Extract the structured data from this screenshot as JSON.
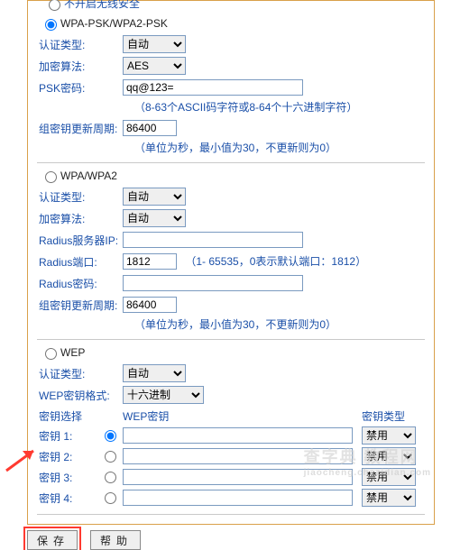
{
  "sec0": {
    "opt_label": "不开启无线安全"
  },
  "sec1": {
    "opt_label": "WPA-PSK/WPA2-PSK",
    "auth_label": "认证类型:",
    "auth_value": "自动",
    "algo_label": "加密算法:",
    "algo_value": "AES",
    "psk_label": "PSK密码:",
    "psk_value": "qq@123=",
    "psk_hint": "（8-63个ASCII码字符或8-64个十六进制字符）",
    "gkp_label": "组密钥更新周期:",
    "gkp_value": "86400",
    "gkp_hint": "（单位为秒，最小值为30，不更新则为0）"
  },
  "sec2": {
    "opt_label": "WPA/WPA2",
    "auth_label": "认证类型:",
    "auth_value": "自动",
    "algo_label": "加密算法:",
    "algo_value": "自动",
    "radius_ip_label": "Radius服务器IP:",
    "radius_ip_value": "",
    "radius_port_label": "Radius端口:",
    "radius_port_value": "1812",
    "radius_port_hint": "（1- 65535，0表示默认端口：1812）",
    "radius_pwd_label": "Radius密码:",
    "radius_pwd_value": "",
    "gkp_label": "组密钥更新周期:",
    "gkp_value": "86400",
    "gkp_hint": "（单位为秒，最小值为30，不更新则为0）"
  },
  "sec3": {
    "opt_label": "WEP",
    "auth_label": "认证类型:",
    "auth_value": "自动",
    "fmt_label": "WEP密钥格式:",
    "fmt_value": "十六进制",
    "head_sel": "密钥选择",
    "head_key": "WEP密钥",
    "head_type": "密钥类型",
    "rows": [
      {
        "label": "密钥 1:",
        "type": "禁用"
      },
      {
        "label": "密钥 2:",
        "type": "禁用"
      },
      {
        "label": "密钥 3:",
        "type": "禁用"
      },
      {
        "label": "密钥 4:",
        "type": "禁用"
      }
    ]
  },
  "buttons": {
    "save": "保存",
    "help": "帮助"
  },
  "watermark": {
    "line1": "查字典 教程网",
    "line2": "jiaocheng.chazidian.com"
  }
}
